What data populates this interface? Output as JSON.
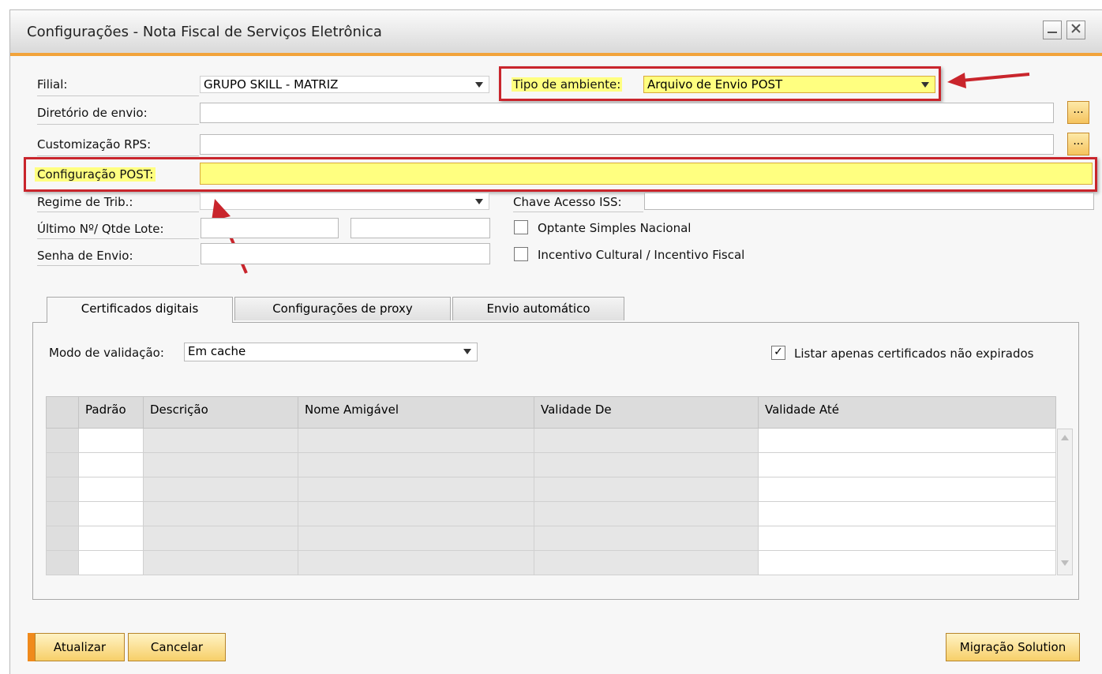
{
  "window": {
    "title": "Configurações - Nota Fiscal de Serviços Eletrônica",
    "minimize_icon": "minimize-icon",
    "close_icon": "close-icon"
  },
  "form": {
    "filial_label": "Filial:",
    "filial_value": "GRUPO SKILL - MATRIZ",
    "tipo_ambiente_label": "Tipo de ambiente:",
    "tipo_ambiente_value": "Arquivo de Envio POST",
    "diretorio_label": "Diretório de envio:",
    "diretorio_value": "",
    "customizacao_label": "Customização RPS:",
    "customizacao_value": "",
    "browse_label": "...",
    "config_post_label": "Configuração POST:",
    "config_post_value": "",
    "regime_label": "Regime de Trib.:",
    "regime_value": "",
    "chave_label": "Chave Acesso ISS:",
    "chave_value": "",
    "ultimo_label": "Último Nº/ Qtde  Lote:",
    "ultimo_value": "",
    "qtde_lote_value": "",
    "senha_label": "Senha de Envio:",
    "senha_value": "",
    "optante_label": "Optante Simples Nacional",
    "optante_checked": false,
    "incentivo_label": "Incentivo Cultural / Incentivo Fiscal",
    "incentivo_checked": false
  },
  "tabs": [
    {
      "label": "Certificados digitais",
      "active": true
    },
    {
      "label": "Configurações de proxy",
      "active": false
    },
    {
      "label": "Envio automático",
      "active": false
    }
  ],
  "certificados": {
    "modo_label": "Modo de validação:",
    "modo_value": "Em cache",
    "listar_label": "Listar apenas certificados não expirados",
    "listar_checked": true,
    "checkmark": "✓",
    "columns": [
      "",
      "Padrão",
      "Descrição",
      "Nome Amigável",
      "Validade De",
      "Validade Até"
    ],
    "row_count": 6
  },
  "buttons": {
    "atualizar": "Atualizar",
    "cancelar": "Cancelar",
    "migracao": "Migração Solution"
  },
  "annotations": {
    "highlight_color": "#c9252c",
    "highlight_fill": "#ffff80"
  }
}
